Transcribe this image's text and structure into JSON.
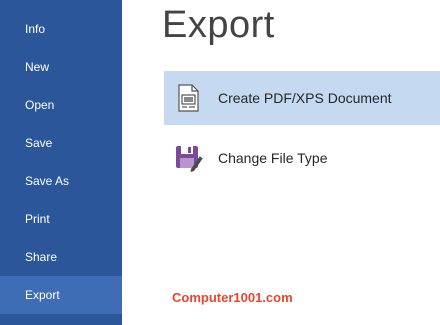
{
  "sidebar": {
    "items": [
      {
        "label": "Info"
      },
      {
        "label": "New"
      },
      {
        "label": "Open"
      },
      {
        "label": "Save"
      },
      {
        "label": "Save As"
      },
      {
        "label": "Print"
      },
      {
        "label": "Share"
      },
      {
        "label": "Export",
        "active": true
      }
    ],
    "background_color": "#2b579a",
    "active_color": "#3e6db5"
  },
  "main": {
    "title": "Export",
    "options": [
      {
        "label": "Create PDF/XPS Document",
        "icon": "pdf-xps-document-icon",
        "selected": true
      },
      {
        "label": "Change File Type",
        "icon": "change-file-type-icon",
        "selected": false
      }
    ],
    "selected_color": "#c5d9f1"
  },
  "watermark": {
    "text": "Computer1001.com",
    "color": "#e8452c"
  }
}
